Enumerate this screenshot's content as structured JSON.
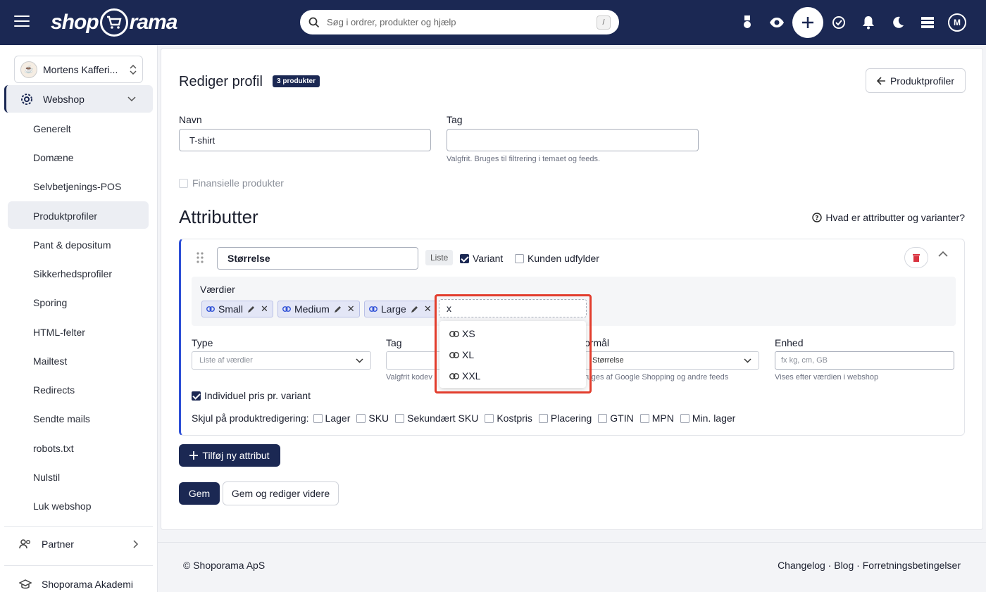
{
  "header": {
    "logo_left": "shop",
    "logo_right": "rama",
    "search_placeholder": "Søg i ordrer, produkter og hjælp",
    "search_shortcut": "/",
    "avatar_initial": "M"
  },
  "sidebar": {
    "shop_name": "Mortens Kafferi...",
    "section": "Webshop",
    "items": [
      "Generelt",
      "Domæne",
      "Selvbetjenings-POS",
      "Produktprofiler",
      "Pant & depositum",
      "Sikkerhedsprofiler",
      "Sporing",
      "HTML-felter",
      "Mailtest",
      "Redirects",
      "Sendte mails",
      "robots.txt",
      "Nulstil",
      "Luk webshop"
    ],
    "active_item": "Produktprofiler",
    "partner": "Partner",
    "academy": "Shoporama Akademi"
  },
  "page": {
    "title": "Rediger profil",
    "badge": "3 produkter",
    "back_button": "Produktprofiler",
    "name_label": "Navn",
    "name_value": "T-shirt",
    "tag_label": "Tag",
    "tag_value": "",
    "tag_help": "Valgfrit. Bruges til filtrering i temaet og feeds.",
    "financial_label": "Finansielle produkter",
    "attributes_heading": "Attributter",
    "attributes_help": "Hvad er attributter og varianter?"
  },
  "attribute": {
    "name": "Størrelse",
    "kind": "Liste",
    "variant_label": "Variant",
    "customer_fills_label": "Kunden udfylder",
    "values_label": "Værdier",
    "values": [
      "Small",
      "Medium",
      "Large"
    ],
    "new_value_input": "x",
    "suggestions": [
      "XS",
      "XL",
      "XXL"
    ],
    "type_label": "Type",
    "type_placeholder": "Liste af værdier",
    "tag_label": "Tag",
    "tag_help": "Valgfrit kodev",
    "purpose_label": "ormål",
    "purpose_value": "Størrelse",
    "purpose_help": "ruges af Google Shopping og andre feeds",
    "unit_label": "Enhed",
    "unit_placeholder": "fx kg, cm, GB",
    "unit_help": "Vises efter værdien i webshop",
    "individual_price_label": "Individuel pris pr. variant",
    "hide_label": "Skjul på produktredigering:",
    "hide_options": [
      "Lager",
      "SKU",
      "Sekundært SKU",
      "Kostpris",
      "Placering",
      "GTIN",
      "MPN",
      "Min. lager"
    ]
  },
  "actions": {
    "add_attribute": "Tilføj ny attribut",
    "save": "Gem",
    "save_continue": "Gem og rediger videre"
  },
  "footer": {
    "copyright": "© Shoporama ApS",
    "links": "Changelog · Blog · Forretningsbetingelser"
  }
}
